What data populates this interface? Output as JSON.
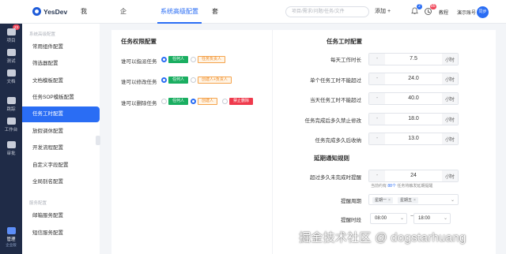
{
  "app": {
    "logo_text": "YesDev"
  },
  "topnav": {
    "items": [
      "我的信息",
      "企业管理",
      "系统高级配置",
      "套餐"
    ],
    "active_index": 2
  },
  "search": {
    "placeholder": "项目/需求/问题/任务/文件"
  },
  "header": {
    "add_label": "添加",
    "bell_badge": "2",
    "clock_badge": "85",
    "tutorial_label": "教程",
    "account_label": "演示账号",
    "avatar_text": "同步"
  },
  "rail": {
    "badge": "23",
    "items": [
      "项目",
      "测试",
      "文档",
      "跳踪",
      "工作台",
      "审批"
    ],
    "bottom_label": "管理",
    "bottom_sub": "企业版"
  },
  "sidebar": {
    "group1": "系统高级配置",
    "items": [
      "常用组件配置",
      "筛选器配置",
      "文档模板配置",
      "任务SOP模板配置",
      "任务工时配置",
      "放假调休配置",
      "开发流程配置",
      "自定义字段配置",
      "全局别名配置"
    ],
    "active_index": 4,
    "group2": "服务配置",
    "items2": [
      "邮箱服务配置",
      "短信服务配置"
    ]
  },
  "permissions": {
    "title": "任务权限配置",
    "rows": [
      {
        "label": "谁可以指派任务",
        "options": [
          {
            "text": "任何人",
            "color": "green",
            "selected": true
          },
          {
            "text": "任务负责人",
            "color": "orange",
            "selected": false
          }
        ]
      },
      {
        "label": "谁可以修改任务",
        "options": [
          {
            "text": "任何人",
            "color": "green",
            "selected": true
          },
          {
            "text": "创建人+负责人",
            "color": "orange",
            "selected": false
          }
        ]
      },
      {
        "label": "谁可以删除任务",
        "options": [
          {
            "text": "任何人",
            "color": "green",
            "selected": false
          },
          {
            "text": "创建人",
            "color": "orange",
            "selected": true
          },
          {
            "text": "禁止删除",
            "color": "red",
            "selected": false
          }
        ]
      }
    ]
  },
  "workhours": {
    "title": "任务工时配置",
    "rows": [
      {
        "label": "每天工作时长",
        "value": "7.5",
        "unit": "小时"
      },
      {
        "label": "单个任务工时不能超过",
        "value": "24.0",
        "unit": "小时"
      },
      {
        "label": "当天任务工时不能超过",
        "value": "40.0",
        "unit": "小时"
      },
      {
        "label": "任务完成后多久禁止修改",
        "value": "18.0",
        "unit": "小时"
      },
      {
        "label": "任务完成多久后收纳",
        "value": "13.0",
        "unit": "小时"
      }
    ],
    "minus": "-",
    "plus": "+"
  },
  "reminder": {
    "title": "延期通知规则",
    "threshold_label": "超过多久未完成时提醒",
    "threshold_value": "24",
    "threshold_unit": "小时",
    "hint_prefix": "当前约有",
    "hint_count": "88个",
    "hint_suffix": "任务将触发延期提醒",
    "period_label": "提醒周期",
    "period_chips": [
      "星期一",
      "星期五"
    ],
    "time_label": "提醒时段",
    "time_start": "08:00",
    "time_end": "18:00",
    "time_sep": "~"
  },
  "watermark": "掘金技术社区 @ dogstarhuang"
}
